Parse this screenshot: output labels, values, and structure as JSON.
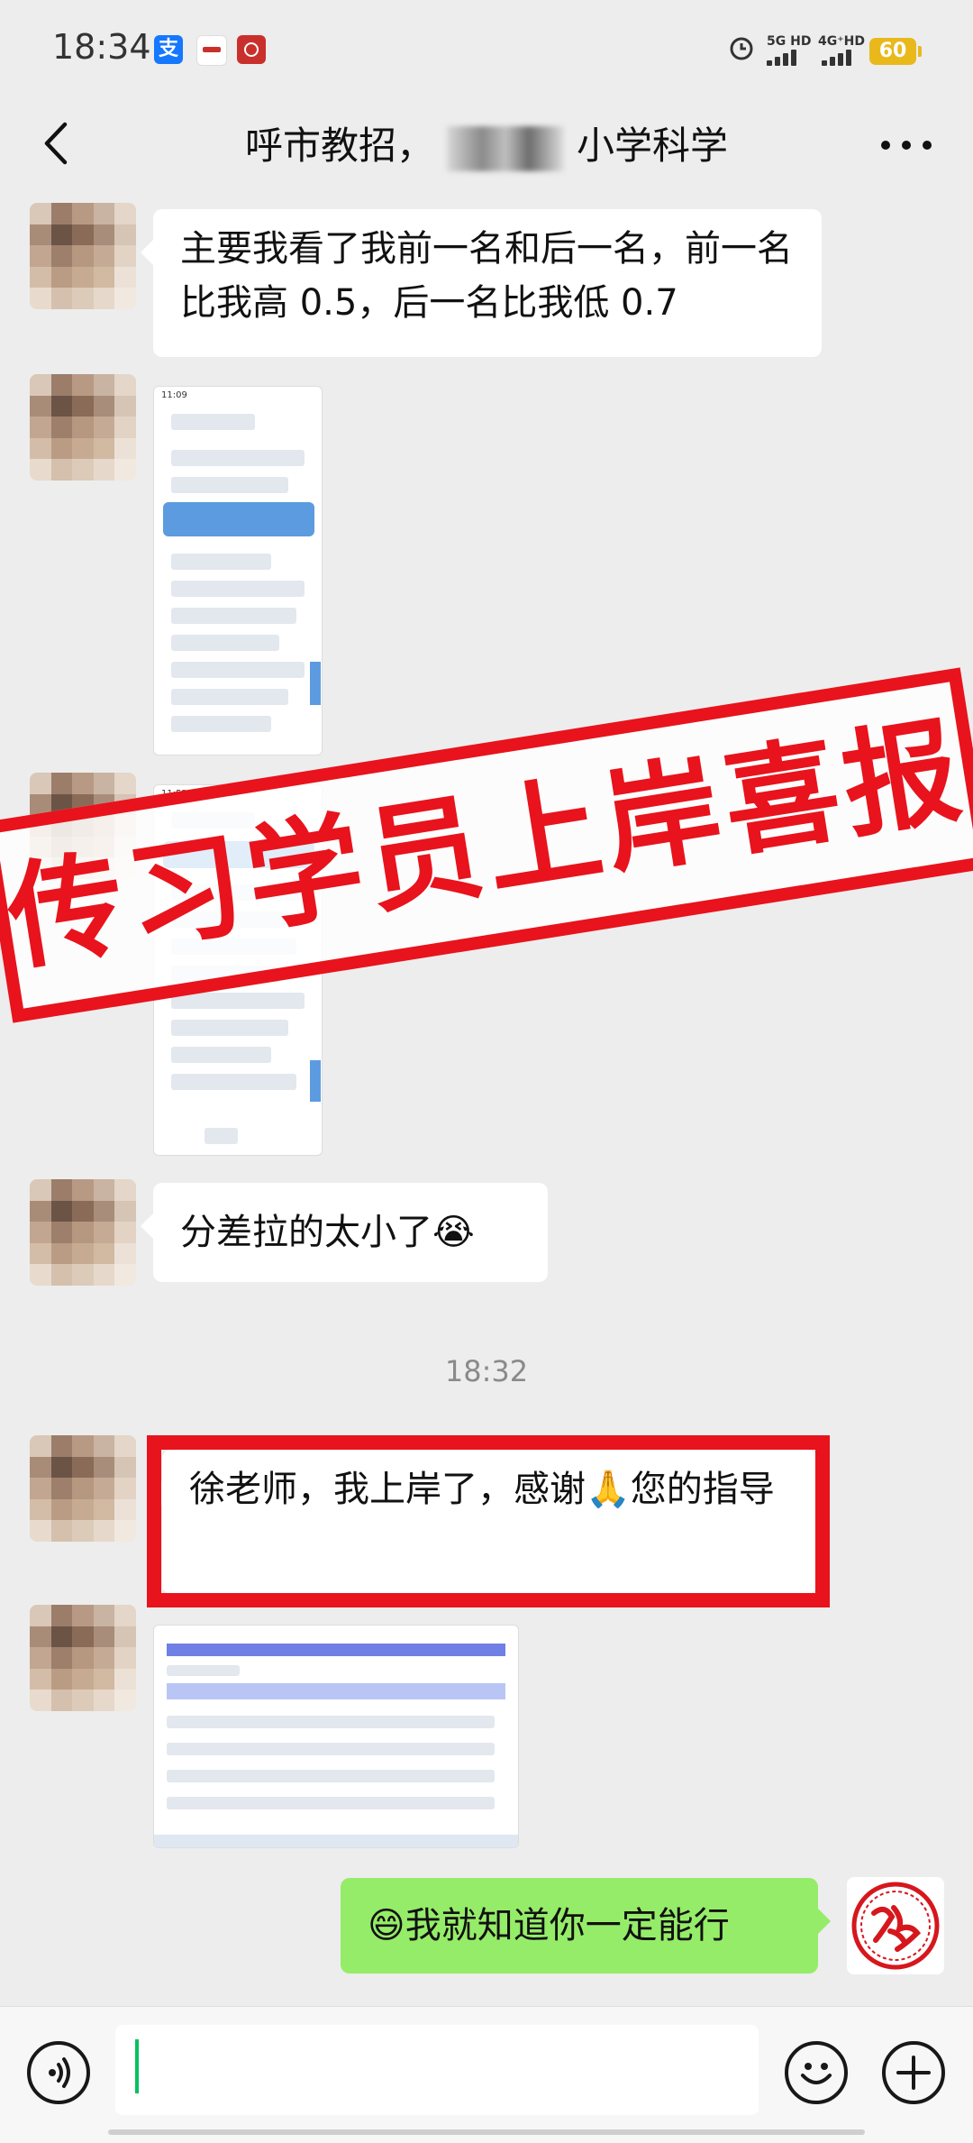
{
  "status_bar": {
    "time": "18:34",
    "network1": "5G HD",
    "network2": "4G⁺HD",
    "battery": "60"
  },
  "header": {
    "title_left": "呼市教招，",
    "title_right": "小学科学"
  },
  "messages": {
    "m1": "主要我看了我前一名和后一名，前一名比我高 0.5，后一名比我低 0.7",
    "m2": "分差拉的太小了😭",
    "timestamp": "18:32",
    "m3": "徐老师，我上岸了，感谢🙏您的指导",
    "m4": "😄我就知道你一定能行"
  },
  "screenshots": {
    "s1_time": "11:09",
    "s2_time": "11:52"
  },
  "banner": "传习学员上岸喜报",
  "input": {
    "value": ""
  },
  "colors": {
    "outgoing_bubble": "#95ec69",
    "accent_red": "#e8131c",
    "background": "#ededed"
  }
}
